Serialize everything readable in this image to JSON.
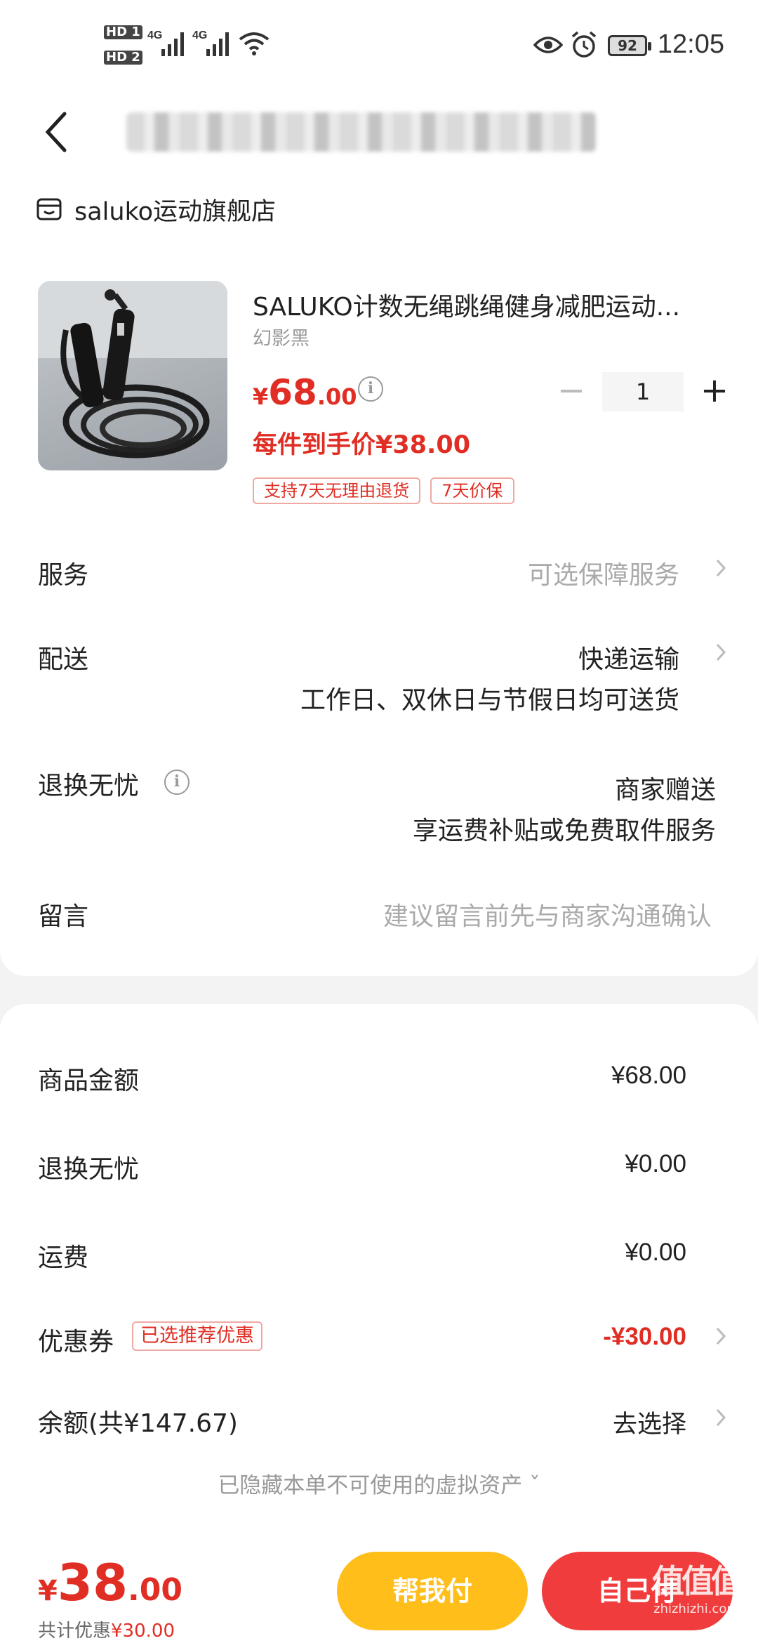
{
  "status_bar": {
    "hd1": "HD 1",
    "hd2": "HD 2",
    "net1": "4G",
    "net2": "4G",
    "battery": "92",
    "time": "12:05"
  },
  "store": {
    "name": "saluko运动旗舰店"
  },
  "product": {
    "title": "SALUKO计数无绳跳绳健身减肥运动...",
    "variant": "幻影黑",
    "price_currency": "¥",
    "price_int": "68",
    "price_dec": ".00",
    "net_price": "每件到手价¥38.00",
    "quantity": "1",
    "tags": [
      "支持7天无理由退货",
      "7天价保"
    ]
  },
  "rows": {
    "service_label": "服务",
    "service_value": "可选保障服务",
    "delivery_label": "配送",
    "delivery_value": "快递运输",
    "delivery_note": "工作日、双休日与节假日均可送货",
    "return_label": "退换无忧",
    "return_value": "商家赠送",
    "return_note": "享运费补贴或免费取件服务",
    "message_label": "留言",
    "message_placeholder": "建议留言前先与商家沟通确认"
  },
  "summary": {
    "goods_label": "商品金额",
    "goods_value": "¥68.00",
    "return_label": "退换无忧",
    "return_value": "¥0.00",
    "shipping_label": "运费",
    "shipping_value": "¥0.00",
    "coupon_label": "优惠券",
    "coupon_badge": "已选推荐优惠",
    "coupon_value": "-¥30.00",
    "balance_label": "余额(共¥147.67)",
    "balance_value": "去选择",
    "hidden_assets": "已隐藏本单不可使用的虚拟资产 ˇ"
  },
  "bottom": {
    "total_currency": "¥",
    "total_int": "38",
    "total_dec": ".00",
    "saved_prefix": "共计优惠",
    "saved_value": "¥30.00",
    "help_pay": "帮我付",
    "self_pay": "自己付"
  },
  "watermark": {
    "logo": "值值值",
    "sub": "zhizhizhi.com"
  },
  "colors": {
    "accent_red": "#e02e24",
    "pay_red": "#f03c3c",
    "help_yellow": "#ffbe1a"
  }
}
